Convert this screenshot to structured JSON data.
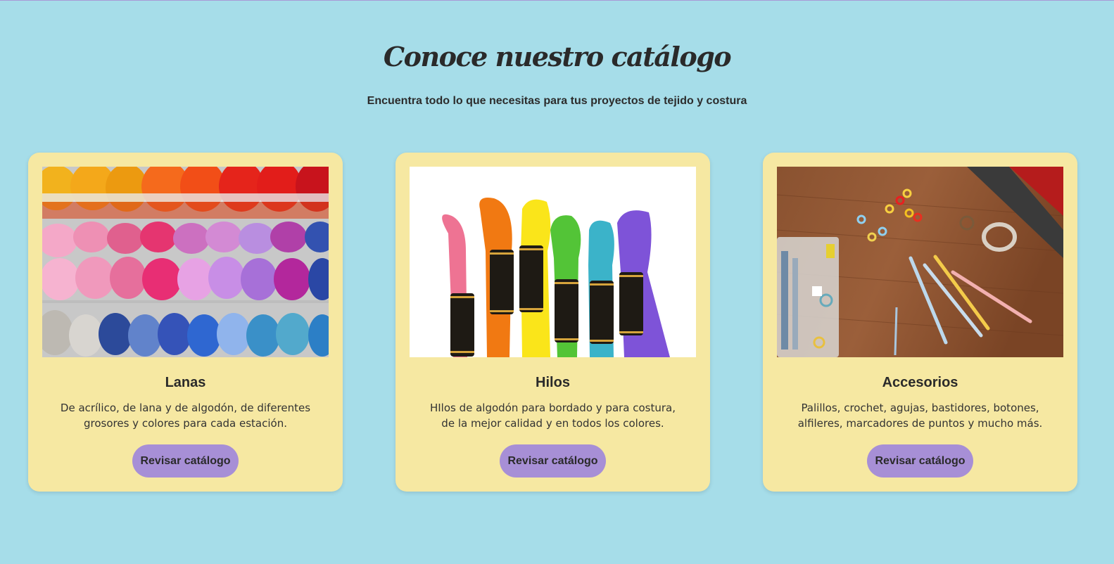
{
  "section": {
    "title": "Conoce nuestro catálogo",
    "subtitle": "Encuentra todo lo que necesitas para tus proyectos de tejido y costura"
  },
  "colors": {
    "background": "#a6dde9",
    "card": "#f6e8a2",
    "button": "#a78fd6"
  },
  "cards": [
    {
      "title": "Lanas",
      "description": "De acrílico, de lana y de algodón, de diferentes grosores y colores para cada estación.",
      "button_label": "Revisar catálogo",
      "image": "yarn-balls-image"
    },
    {
      "title": "Hilos",
      "description": "HIlos de algodón para bordado y para costura, de la mejor calidad y en todos los colores.",
      "button_label": "Revisar catálogo",
      "image": "embroidery-thread-image"
    },
    {
      "title": "Accesorios",
      "description": "Palillos, crochet, agujas, bastidores, botones, alfileres, marcadores de puntos y mucho más.",
      "button_label": "Revisar catálogo",
      "image": "accessories-image"
    }
  ]
}
